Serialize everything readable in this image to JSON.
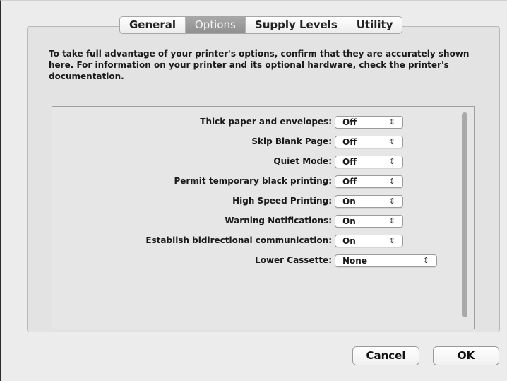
{
  "tabs": [
    {
      "label": "General",
      "selected": false
    },
    {
      "label": "Options",
      "selected": true
    },
    {
      "label": "Supply Levels",
      "selected": false
    },
    {
      "label": "Utility",
      "selected": false
    }
  ],
  "intro_text": "To take full advantage of your printer's options, confirm that they are accurately shown here. For information on your printer and its optional hardware, check the printer's documentation.",
  "options": [
    {
      "label": "Thick paper and envelopes:",
      "value": "Off"
    },
    {
      "label": "Skip Blank Page:",
      "value": "Off"
    },
    {
      "label": "Quiet Mode:",
      "value": "Off"
    },
    {
      "label": "Permit temporary black printing:",
      "value": "Off"
    },
    {
      "label": "High Speed Printing:",
      "value": "On"
    },
    {
      "label": "Warning Notifications:",
      "value": "On"
    },
    {
      "label": "Establish bidirectional communication:",
      "value": "On"
    },
    {
      "label": "Lower Cassette:",
      "value": "None"
    }
  ],
  "icons": {
    "popup_arrows": "up-down-chevron-icon"
  },
  "buttons": {
    "cancel": "Cancel",
    "ok": "OK"
  }
}
